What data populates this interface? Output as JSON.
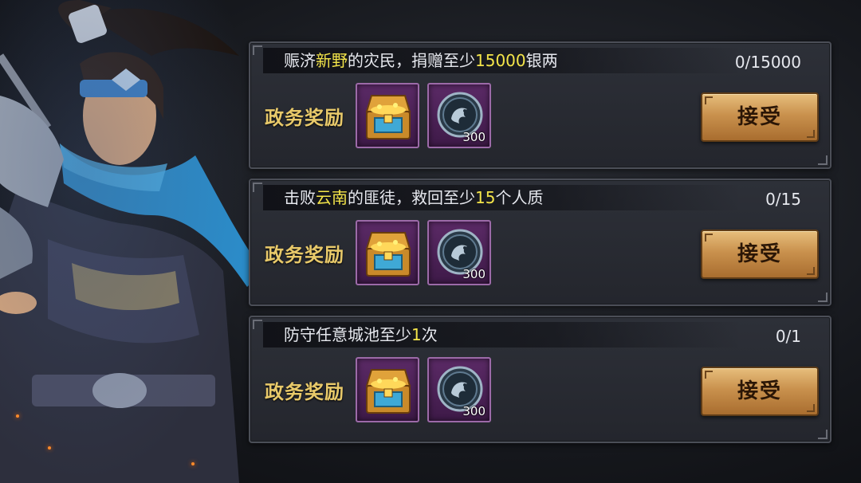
{
  "quests": [
    {
      "title_parts": [
        "赈济",
        "新野",
        "的灾民，捐赠至少",
        "15000",
        "银两"
      ],
      "progress": "0/15000",
      "reward_label": "政务奖励",
      "reward_count": "300",
      "accept_label": "接受"
    },
    {
      "title_parts": [
        "击败",
        "云南",
        "的匪徒，救回至少",
        "15",
        "个人质"
      ],
      "progress": "0/15",
      "reward_label": "政务奖励",
      "reward_count": "300",
      "accept_label": "接受"
    },
    {
      "title_parts": [
        "防守任意城池至少",
        "1",
        "次",
        "",
        ""
      ],
      "progress": "0/1",
      "reward_label": "政务奖励",
      "reward_count": "300",
      "accept_label": "接受"
    }
  ],
  "colors": {
    "highlight": "#f4e54a",
    "reward_label": "#e8c96a",
    "button_gold": "#c9914d",
    "slot_purple": "#5b2a66"
  },
  "icons": {
    "reward_1": "treasure-chest-icon",
    "reward_2": "dragon-coin-icon"
  }
}
